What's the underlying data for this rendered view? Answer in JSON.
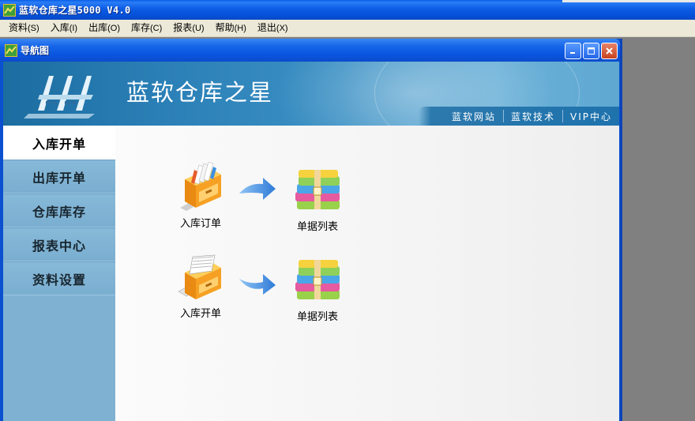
{
  "app": {
    "title": "蓝软仓库之星5000 V4.0"
  },
  "menu": [
    {
      "label": "资料",
      "accel": "(S)"
    },
    {
      "label": "入库",
      "accel": "(I)"
    },
    {
      "label": "出库",
      "accel": "(O)"
    },
    {
      "label": "库存",
      "accel": "(C)"
    },
    {
      "label": "报表",
      "accel": "(U)"
    },
    {
      "label": "帮助",
      "accel": "(H)"
    },
    {
      "label": "退出",
      "accel": "(X)"
    }
  ],
  "nav_window": {
    "title": "导航图"
  },
  "banner": {
    "brand": "蓝软仓库之星",
    "links": [
      "蓝软网站",
      "蓝软技术",
      "VIP中心"
    ]
  },
  "sidebar": {
    "items": [
      {
        "label": "入库开单",
        "active": true
      },
      {
        "label": "出库开单",
        "active": false
      },
      {
        "label": "仓库库存",
        "active": false
      },
      {
        "label": "报表中心",
        "active": false
      },
      {
        "label": "资料设置",
        "active": false
      }
    ]
  },
  "flows": [
    {
      "from": {
        "label": "入库订单",
        "icon": "cabinet-folders-icon"
      },
      "to": {
        "label": "单据列表",
        "icon": "stacked-books-icon"
      }
    },
    {
      "from": {
        "label": "入库开单",
        "icon": "cabinet-documents-icon"
      },
      "to": {
        "label": "单据列表",
        "icon": "stacked-books-icon"
      }
    }
  ],
  "colors": {
    "titlebar": "#0a55de",
    "sidebar": "#7fb2d2",
    "banner": "#2a7fb6",
    "close_button": "#c8431f"
  }
}
